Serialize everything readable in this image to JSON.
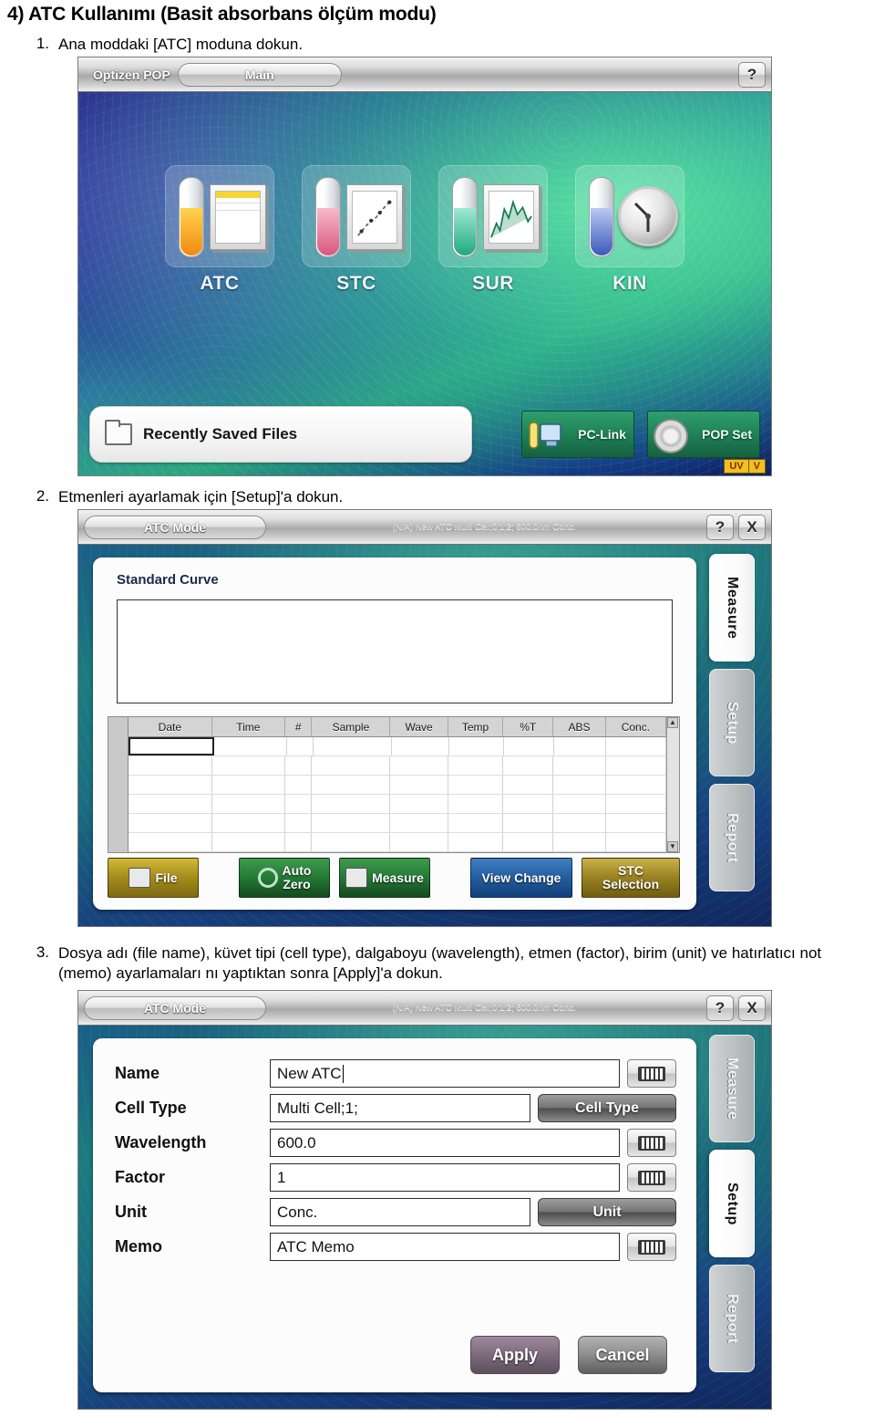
{
  "document": {
    "title": "4) ATC Kullanımı (Basit absorbans ölçüm modu)",
    "steps": [
      {
        "num": "1.",
        "text": "Ana moddaki [ATC] moduna dokun."
      },
      {
        "num": "2.",
        "text": "Etmenleri ayarlamak için [Setup]'a dokun."
      },
      {
        "num": "3.",
        "text": "Dosya adı (file name), küvet tipi (cell type), dalgaboyu (wavelength), etmen (factor), birim (unit) ve hatırlatıcı not (memo) ayarlamaları nı yaptıktan sonra [Apply]'a dokun."
      }
    ]
  },
  "main_screen": {
    "brand": "Optizen POP",
    "tab": "Main",
    "help_label": "?",
    "modes": [
      {
        "label": "ATC",
        "fill": "#f2a81e",
        "icon": "test-tube-table-icon"
      },
      {
        "label": "STC",
        "fill": "#e06f8e",
        "icon": "test-tube-scatter-icon"
      },
      {
        "label": "SUR",
        "fill": "#34c49a",
        "icon": "test-tube-spectrum-icon"
      },
      {
        "label": "KIN",
        "fill": "#4f6fd0",
        "icon": "test-tube-clock-icon"
      }
    ],
    "recent_files_label": "Recently Saved Files",
    "pc_link_label": "PC-Link",
    "pop_set_label": "POP Set",
    "lamp_uv": "UV",
    "lamp_v": "V"
  },
  "atc_measure": {
    "title": "ATC Mode",
    "status": "(N/A) New ATC Multi Cell;0;1;2; 600.0nm Conc.",
    "help_label": "?",
    "close_label": "X",
    "standard_curve_label": "Standard Curve",
    "table": {
      "columns": [
        "Date",
        "Time",
        "#",
        "Sample",
        "Wave",
        "Temp",
        "%T",
        "ABS",
        "Conc."
      ],
      "rows": [
        [],
        [],
        [],
        [],
        [],
        []
      ]
    },
    "buttons": [
      {
        "label": "File",
        "style": "gold",
        "icon": "folder-icon"
      },
      {
        "label": "Auto\nZero",
        "line1": "Auto",
        "line2": "Zero",
        "style": "green",
        "icon": "circle-icon"
      },
      {
        "label": "Measure",
        "style": "green",
        "icon": "check-document-icon"
      },
      {
        "label": "View Change",
        "style": "blue",
        "icon": "none"
      },
      {
        "line1": "STC",
        "line2": "Selection",
        "style": "gold2",
        "icon": "none"
      }
    ],
    "tabs": [
      {
        "label": "Measure",
        "active": true
      },
      {
        "label": "Setup",
        "active": false
      },
      {
        "label": "Report",
        "active": false
      }
    ]
  },
  "atc_setup": {
    "title": "ATC Mode",
    "status": "(N/A) New ATC Multi Cell;0;1;2; 600.0nm Conc.",
    "help_label": "?",
    "close_label": "X",
    "fields": [
      {
        "label": "Name",
        "value": "New ATC",
        "control": "keyboard",
        "caret": true
      },
      {
        "label": "Cell Type",
        "value": "Multi Cell;1;",
        "control": "button",
        "button_label": "Cell Type"
      },
      {
        "label": "Wavelength",
        "value": "600.0",
        "control": "keyboard"
      },
      {
        "label": "Factor",
        "value": "1",
        "control": "keyboard"
      },
      {
        "label": "Unit",
        "value": "Conc.",
        "control": "button",
        "button_label": "Unit"
      },
      {
        "label": "Memo",
        "value": "ATC Memo",
        "control": "keyboard"
      }
    ],
    "apply_label": "Apply",
    "cancel_label": "Cancel",
    "tabs": [
      {
        "label": "Measure",
        "active": false
      },
      {
        "label": "Setup",
        "active": true
      },
      {
        "label": "Report",
        "active": false
      }
    ]
  }
}
